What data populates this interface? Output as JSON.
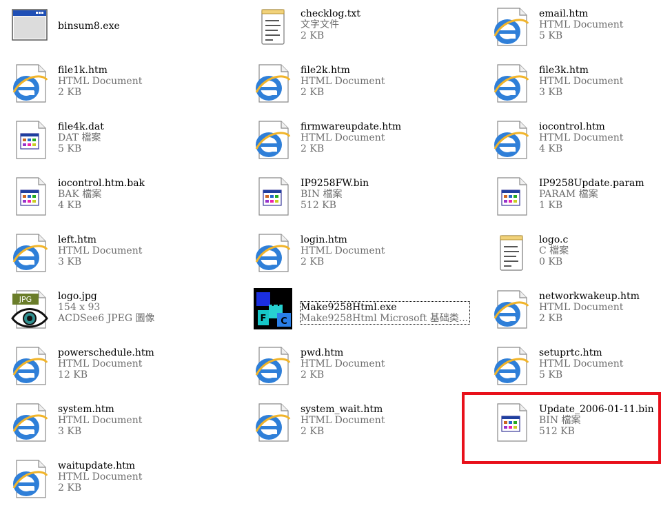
{
  "files": [
    {
      "name": "binsum8.exe",
      "type": "",
      "size": "",
      "icon": "window-exe-icon"
    },
    {
      "name": "checklog.txt",
      "type": "文字文件",
      "size": "2 KB",
      "icon": "notepad-icon"
    },
    {
      "name": "email.htm",
      "type": "HTML Document",
      "size": "5 KB",
      "icon": "ie-html-icon"
    },
    {
      "name": "file1k.htm",
      "type": "HTML Document",
      "size": "2 KB",
      "icon": "ie-html-icon"
    },
    {
      "name": "file2k.htm",
      "type": "HTML Document",
      "size": "2 KB",
      "icon": "ie-html-icon"
    },
    {
      "name": "file3k.htm",
      "type": "HTML Document",
      "size": "3 KB",
      "icon": "ie-html-icon"
    },
    {
      "name": "file4k.dat",
      "type": "DAT 檔案",
      "size": "5 KB",
      "icon": "generic-file-icon"
    },
    {
      "name": "firmwareupdate.htm",
      "type": "HTML Document",
      "size": "2 KB",
      "icon": "ie-html-icon"
    },
    {
      "name": "iocontrol.htm",
      "type": "HTML Document",
      "size": "4 KB",
      "icon": "ie-html-icon"
    },
    {
      "name": "iocontrol.htm.bak",
      "type": "BAK 檔案",
      "size": "4 KB",
      "icon": "generic-file-icon"
    },
    {
      "name": "IP9258FW.bin",
      "type": "BIN 檔案",
      "size": "512 KB",
      "icon": "generic-file-icon"
    },
    {
      "name": "IP9258Update.param",
      "type": "PARAM 檔案",
      "size": "1 KB",
      "icon": "generic-file-icon"
    },
    {
      "name": "left.htm",
      "type": "HTML Document",
      "size": "3 KB",
      "icon": "ie-html-icon"
    },
    {
      "name": "login.htm",
      "type": "HTML Document",
      "size": "2 KB",
      "icon": "ie-html-icon"
    },
    {
      "name": "logo.c",
      "type": "C 檔案",
      "size": "0 KB",
      "icon": "notepad-icon"
    },
    {
      "name": "logo.jpg",
      "type": "154 x 93",
      "size": "ACDSee6 JPEG 圖像",
      "icon": "acdsee-jpeg-icon",
      "badge": "JPG"
    },
    {
      "name": "Make9258Html.exe",
      "type": "Make9258Html Microsoft 基础类...",
      "size": "",
      "icon": "mfc-app-icon",
      "focused": true
    },
    {
      "name": "networkwakeup.htm",
      "type": "HTML Document",
      "size": "2 KB",
      "icon": "ie-html-icon"
    },
    {
      "name": "powerschedule.htm",
      "type": "HTML Document",
      "size": "12 KB",
      "icon": "ie-html-icon"
    },
    {
      "name": "pwd.htm",
      "type": "HTML Document",
      "size": "2 KB",
      "icon": "ie-html-icon"
    },
    {
      "name": "setuprtc.htm",
      "type": "HTML Document",
      "size": "5 KB",
      "icon": "ie-html-icon"
    },
    {
      "name": "system.htm",
      "type": "HTML Document",
      "size": "3 KB",
      "icon": "ie-html-icon"
    },
    {
      "name": "system_wait.htm",
      "type": "HTML Document",
      "size": "2 KB",
      "icon": "ie-html-icon"
    },
    {
      "name": "Update_2006-01-11.bin",
      "type": "BIN 檔案",
      "size": "512 KB",
      "icon": "generic-file-icon",
      "highlighted": true
    },
    {
      "name": "waitupdate.htm",
      "type": "HTML Document",
      "size": "2 KB",
      "icon": "ie-html-icon"
    }
  ],
  "highlight_color": "#e8101a"
}
